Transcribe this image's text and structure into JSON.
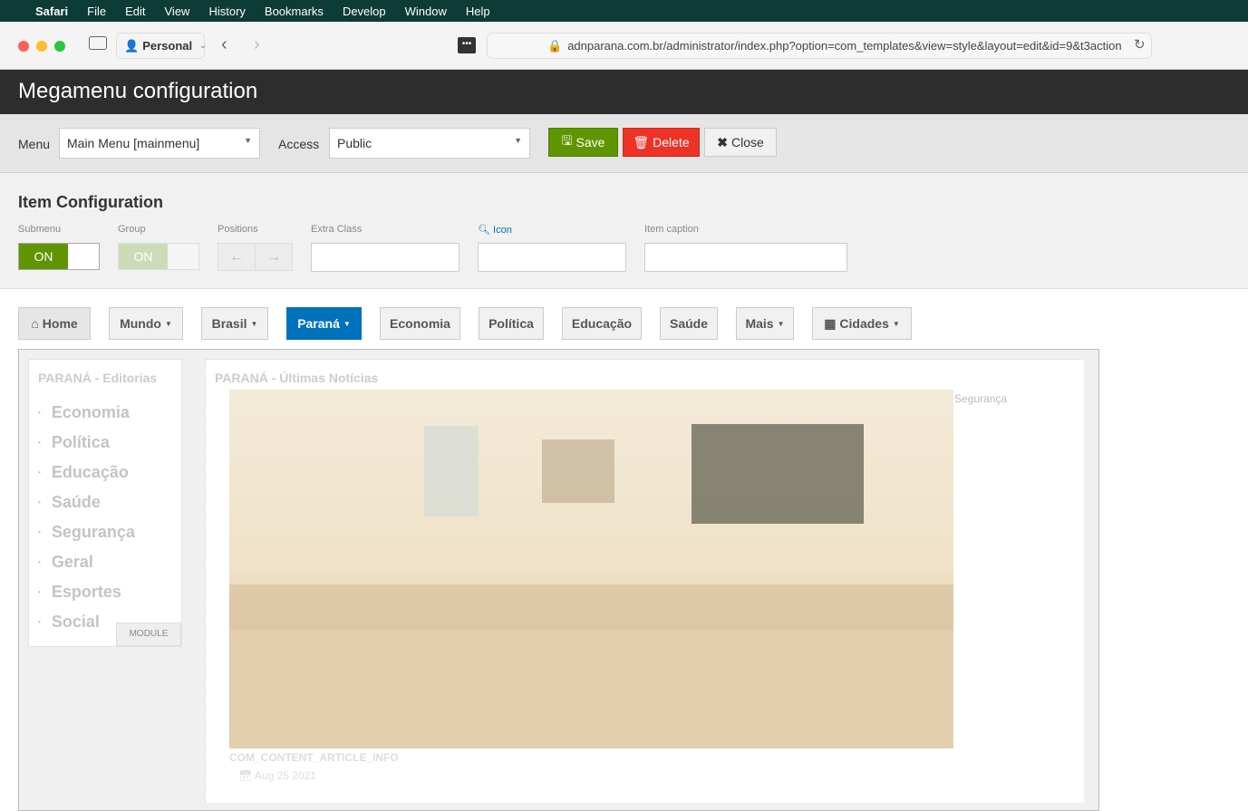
{
  "menubar": {
    "app": "Safari",
    "items": [
      "File",
      "Edit",
      "View",
      "History",
      "Bookmarks",
      "Develop",
      "Window",
      "Help"
    ]
  },
  "browser": {
    "profile": "Personal",
    "url": "adnparana.com.br/administrator/index.php?option=com_templates&view=style&layout=edit&id=9&t3action"
  },
  "header": {
    "title": "Megamenu configuration"
  },
  "toolbar": {
    "menu_label": "Menu",
    "menu_value": "Main Menu [mainmenu]",
    "access_label": "Access",
    "access_value": "Public",
    "save": "Save",
    "delete": "Delete",
    "close": "Close"
  },
  "config": {
    "title": "Item Configuration",
    "submenu": "Submenu",
    "group": "Group",
    "positions": "Positions",
    "extra_class": "Extra Class",
    "icon": "Icon",
    "item_caption": "Item caption",
    "on": "ON"
  },
  "nav": [
    "Home",
    "Mundo",
    "Brasil",
    "Paraná",
    "Economia",
    "Política",
    "Educação",
    "Saúde",
    "Mais",
    "Cidades"
  ],
  "sidebar": {
    "title": "PARANÁ - Editorias",
    "items": [
      "Economia",
      "Política",
      "Educação",
      "Saúde",
      "Segurança",
      "Geral",
      "Esportes",
      "Social"
    ],
    "tag": "MODULE"
  },
  "main": {
    "title": "PARANÁ - Últimas Notícias",
    "category": "Segurança",
    "info": "COM_CONTENT_ARTICLE_INFO",
    "date": "Aug 25 2021"
  },
  "colors": {
    "accent": "#0072bc",
    "save": "#5f9500",
    "delete": "#ef3227"
  }
}
